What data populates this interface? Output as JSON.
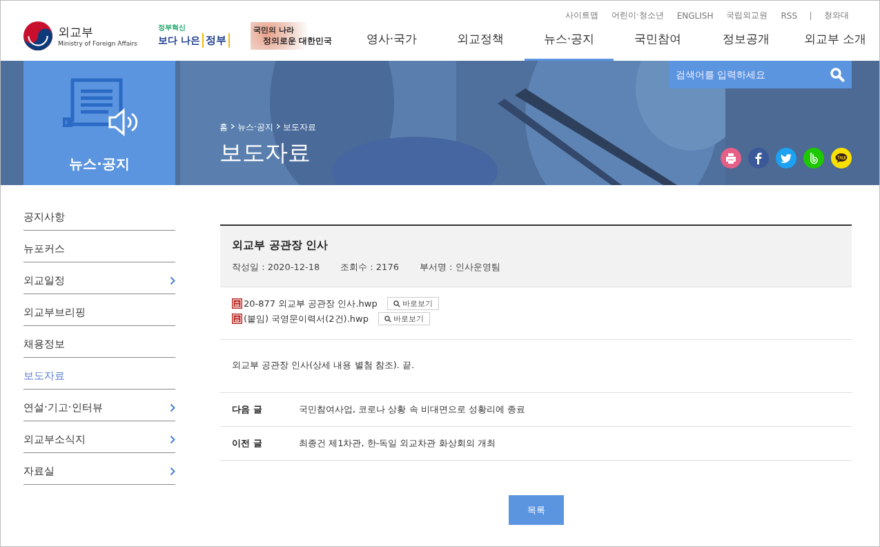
{
  "logos": [
    {
      "kind": "ministry",
      "title": "외교부",
      "subtitle": "Ministry of Foreign Affairs"
    },
    {
      "kind": "innovation",
      "title": "정부혁신",
      "subtitle": "보다 나은",
      "badge": "정부"
    },
    {
      "kind": "slogan",
      "title": "국민의 나라",
      "subtitle": "정의로운 대한민국"
    }
  ],
  "utility_links": [
    "사이트맵",
    "어린이·청소년",
    "ENGLISH",
    "국립외교원",
    "RSS",
    "청와대"
  ],
  "nav": [
    {
      "label": "영사·국가",
      "selected": false
    },
    {
      "label": "외교정책",
      "selected": false
    },
    {
      "label": "뉴스·공지",
      "selected": true
    },
    {
      "label": "국민참여",
      "selected": false
    },
    {
      "label": "정보공개",
      "selected": false
    },
    {
      "label": "외교부 소개",
      "selected": false
    }
  ],
  "banner": {
    "section": "뉴스·공지",
    "breadcrumb": [
      "홈",
      "뉴스·공지",
      "보도자료"
    ],
    "title": "보도자료",
    "search": {
      "placeholder": "검색어를 입력하세요"
    },
    "share": [
      {
        "kind": "print",
        "color": "#e65f87"
      },
      {
        "kind": "facebook",
        "color": "#3b5998"
      },
      {
        "kind": "twitter",
        "color": "#1da1f2"
      },
      {
        "kind": "band",
        "color": "#1ec800"
      },
      {
        "kind": "kakao",
        "color": "#f9e000"
      }
    ]
  },
  "sidebar": {
    "items": [
      {
        "label": "공지사항",
        "expandable": false,
        "selected": false
      },
      {
        "label": "뉴포커스",
        "expandable": false,
        "selected": false
      },
      {
        "label": "외교일정",
        "expandable": true,
        "selected": false
      },
      {
        "label": "외교부브리핑",
        "expandable": false,
        "selected": false
      },
      {
        "label": "채용정보",
        "expandable": false,
        "selected": false
      },
      {
        "label": "보도자료",
        "expandable": false,
        "selected": true
      },
      {
        "label": "연설·기고·인터뷰",
        "expandable": true,
        "selected": false
      },
      {
        "label": "외교부소식지",
        "expandable": true,
        "selected": false
      },
      {
        "label": "자료실",
        "expandable": true,
        "selected": false
      }
    ]
  },
  "article": {
    "title": "외교부 공관장 인사",
    "meta": [
      "작성일 : 2020-12-18",
      "조회수 : 2176",
      "부서명 : 인사운영팀"
    ],
    "attachments": [
      {
        "name": "20-877 외교부 공관장 인사.hwp",
        "preview": "바로보기"
      },
      {
        "name": "(붙임) 국영문이력서(2건).hwp",
        "preview": "바로보기"
      }
    ],
    "body": "외교부 공관장 인사(상세 내용 별첨 참조).  끝.",
    "navigation": [
      {
        "label": "다음 글",
        "title": "국민참여사업, 코로나 상황 속 비대면으로 성황리에 종료"
      },
      {
        "label": "이전 글",
        "title": "최종건 제1차관, 한-독일 외교차관 화상회의 개최"
      }
    ],
    "list_button": "목록"
  }
}
